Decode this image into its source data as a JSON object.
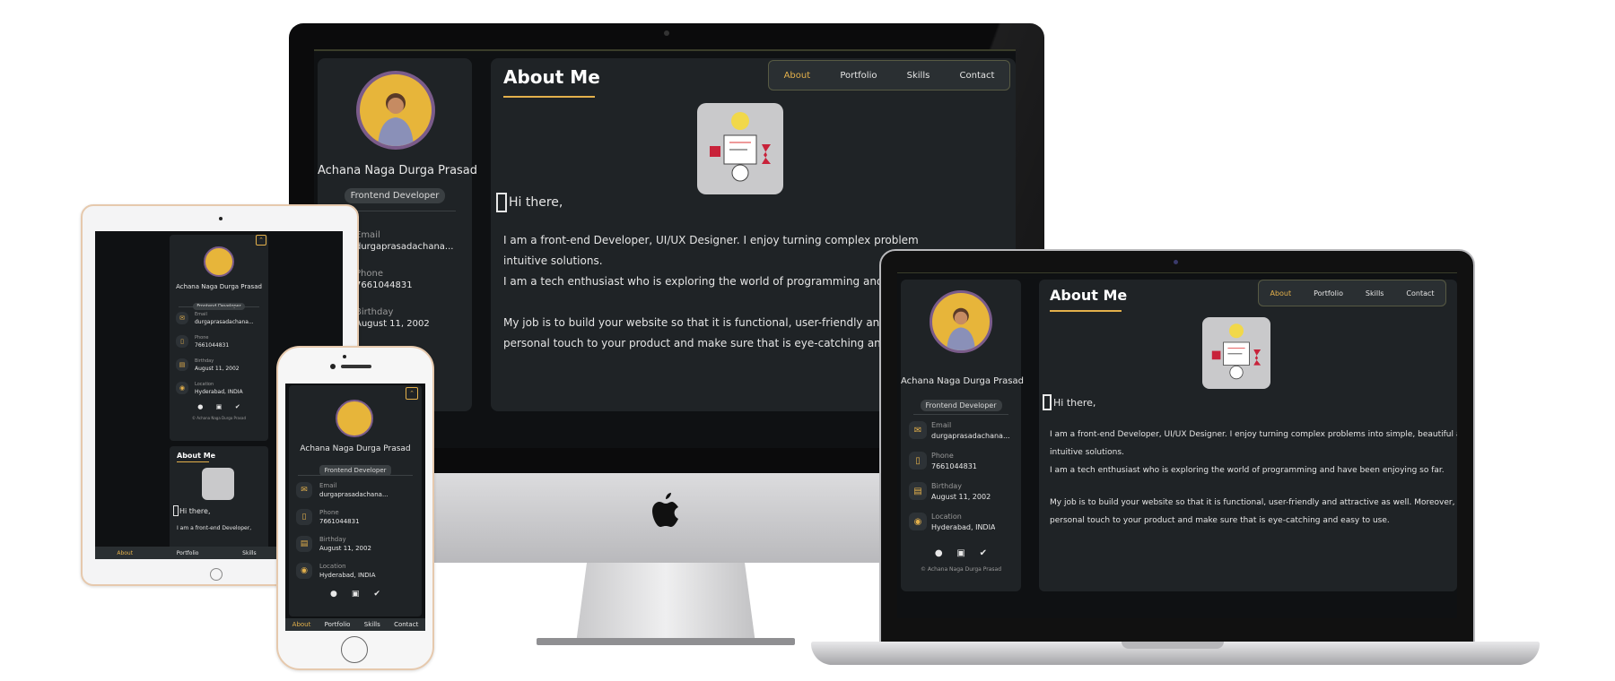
{
  "profile": {
    "name": "Achana Naga Durga Prasad",
    "role": "Frontend Developer",
    "email_label": "Email",
    "email": "durgaprasadachana...",
    "email_full": "durgaprasadachana...",
    "phone_label": "Phone",
    "phone": "7661044831",
    "birthday_label": "Birthday",
    "birthday": "August 11, 2002",
    "location_label": "Location",
    "location": "Hyderabad, INDIA",
    "footer": "© Achana Naga Durga Prasad"
  },
  "nav": {
    "about": "About",
    "portfolio": "Portfolio",
    "skills": "Skills",
    "contact": "Contact"
  },
  "about": {
    "title": "About Me",
    "greeting": "Hi there,",
    "p1": "I am a front-end Developer, UI/UX Designer. I enjoy turning complex problems into simple, beautiful and",
    "p1b": "intuitive solutions.",
    "p2": "I am a tech enthusiast who is exploring the world of programming and have been enjoying so far.",
    "p3": "My job is to build your website so that it is functional, user-friendly and attractive as well. Moreover, I add",
    "p3b": "personal touch to your product and make sure that is eye-catching and easy to use.",
    "desk_p1": "I am a front-end Developer, UI/UX Designer. I enjoy turning complex problem",
    "desk_p2": "I am a tech enthusiast who is exploring the world of programming and have",
    "desk_p3": "My job is to build your website so that it is functional, user-friendly and attra",
    "desk_p3b": "personal touch to your product and make sure that is eye-catching and easy",
    "tablet_p": "I am a front-end Developer,"
  },
  "icons": {
    "social": [
      "github-icon",
      "linkedin-icon",
      "twitter-icon"
    ]
  },
  "colors": {
    "accent": "#e3b04b",
    "panel": "#1f2326",
    "screen": "#0f1113"
  }
}
